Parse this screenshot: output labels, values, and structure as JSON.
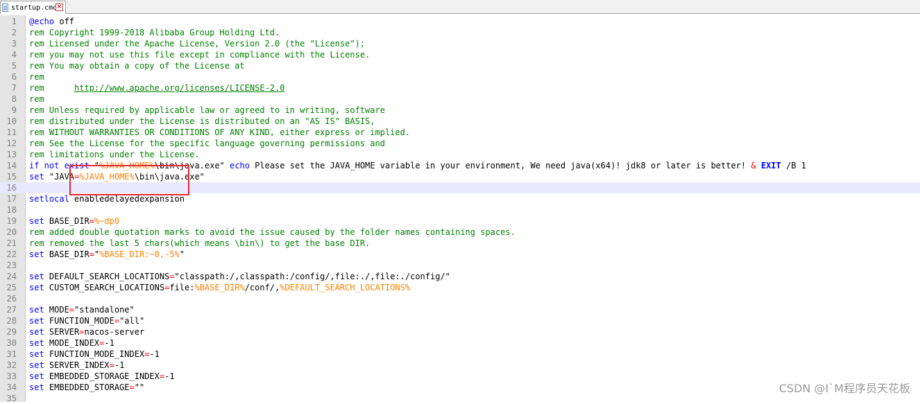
{
  "tab": {
    "title": "startup.cmd",
    "file_icon": "file-icon",
    "close_icon": "close-icon"
  },
  "colors": {
    "keyword": "#0000ff",
    "comment": "#008000",
    "variable": "#ff8000",
    "string": "#808080",
    "operator": "#ff0000",
    "current_line": "#e8e8ff",
    "highlight_box": "#e0262b"
  },
  "current_line": 16,
  "lines": [
    {
      "n": "1",
      "tokens": [
        {
          "t": "@echo",
          "c": "kw"
        },
        {
          "t": " off",
          "c": "plain"
        }
      ]
    },
    {
      "n": "2",
      "tokens": [
        {
          "t": "rem Copyright 1999-2018 Alibaba Group Holding Ltd.",
          "c": "comment"
        }
      ]
    },
    {
      "n": "3",
      "tokens": [
        {
          "t": "rem Licensed under the Apache License, Version 2.0 (the \"License\");",
          "c": "comment"
        }
      ]
    },
    {
      "n": "4",
      "tokens": [
        {
          "t": "rem you may not use this file except in compliance with the License.",
          "c": "comment"
        }
      ]
    },
    {
      "n": "5",
      "tokens": [
        {
          "t": "rem You may obtain a copy of the License at",
          "c": "comment"
        }
      ]
    },
    {
      "n": "6",
      "tokens": [
        {
          "t": "rem",
          "c": "comment"
        }
      ]
    },
    {
      "n": "7",
      "tokens": [
        {
          "t": "rem      ",
          "c": "comment"
        },
        {
          "t": "http://www.apache.org/licenses/LICENSE-2.0",
          "c": "link"
        }
      ]
    },
    {
      "n": "8",
      "tokens": [
        {
          "t": "rem",
          "c": "comment"
        }
      ]
    },
    {
      "n": "9",
      "tokens": [
        {
          "t": "rem Unless required by applicable law or agreed to in writing, software",
          "c": "comment"
        }
      ]
    },
    {
      "n": "10",
      "tokens": [
        {
          "t": "rem distributed under the License is distributed on an \"AS IS\" BASIS,",
          "c": "comment"
        }
      ]
    },
    {
      "n": "11",
      "tokens": [
        {
          "t": "rem WITHOUT WARRANTIES OR CONDITIONS OF ANY KIND, either express or implied.",
          "c": "comment"
        }
      ]
    },
    {
      "n": "12",
      "tokens": [
        {
          "t": "rem See the License for the specific language governing permissions and",
          "c": "comment"
        }
      ]
    },
    {
      "n": "13",
      "tokens": [
        {
          "t": "rem limitations under the License.",
          "c": "comment"
        }
      ]
    },
    {
      "n": "14",
      "tokens": [
        {
          "t": "if not exist",
          "c": "kw"
        },
        {
          "t": " \"",
          "c": "plain"
        },
        {
          "t": "%JAVA_HOME%",
          "c": "var"
        },
        {
          "t": "\\bin\\java.exe\" ",
          "c": "plain"
        },
        {
          "t": "echo",
          "c": "kw"
        },
        {
          "t": " Please set the JAVA_HOME variable in your environment, We need java(x64)! jdk8 or later is better! ",
          "c": "plain"
        },
        {
          "t": "&",
          "c": "op"
        },
        {
          "t": " ",
          "c": "plain"
        },
        {
          "t": "EXIT",
          "c": "kw-bold"
        },
        {
          "t": " /B 1",
          "c": "plain"
        }
      ]
    },
    {
      "n": "15",
      "tokens": [
        {
          "t": "set",
          "c": "kw"
        },
        {
          "t": " \"JAVA",
          "c": "plain"
        },
        {
          "t": "=",
          "c": "op"
        },
        {
          "t": "%JAVA_HOME%",
          "c": "var"
        },
        {
          "t": "\\bin\\java.exe\"",
          "c": "plain"
        }
      ]
    },
    {
      "n": "16",
      "tokens": []
    },
    {
      "n": "17",
      "tokens": [
        {
          "t": "setlocal",
          "c": "kw"
        },
        {
          "t": " enabledelayedexpansion",
          "c": "plain"
        }
      ]
    },
    {
      "n": "18",
      "tokens": []
    },
    {
      "n": "19",
      "tokens": [
        {
          "t": "set",
          "c": "kw"
        },
        {
          "t": " BASE_DIR",
          "c": "plain"
        },
        {
          "t": "=",
          "c": "op"
        },
        {
          "t": "%~dp0",
          "c": "var"
        }
      ]
    },
    {
      "n": "20",
      "tokens": [
        {
          "t": "rem added double quotation marks to avoid the issue caused by the folder names containing spaces.",
          "c": "comment"
        }
      ]
    },
    {
      "n": "21",
      "tokens": [
        {
          "t": "rem removed the last 5 chars(which means \\bin\\) to get the base DIR.",
          "c": "comment"
        }
      ]
    },
    {
      "n": "22",
      "tokens": [
        {
          "t": "set",
          "c": "kw"
        },
        {
          "t": " BASE_DIR",
          "c": "plain"
        },
        {
          "t": "=",
          "c": "op"
        },
        {
          "t": "\"",
          "c": "plain"
        },
        {
          "t": "%BASE_DIR:~0,-5%",
          "c": "var"
        },
        {
          "t": "\"",
          "c": "plain"
        }
      ]
    },
    {
      "n": "23",
      "tokens": []
    },
    {
      "n": "24",
      "tokens": [
        {
          "t": "set",
          "c": "kw"
        },
        {
          "t": " DEFAULT_SEARCH_LOCATIONS",
          "c": "plain"
        },
        {
          "t": "=",
          "c": "op"
        },
        {
          "t": "\"classpath:/,classpath:/config/,file:./,file:./config/\"",
          "c": "plain"
        }
      ]
    },
    {
      "n": "25",
      "tokens": [
        {
          "t": "set",
          "c": "kw"
        },
        {
          "t": " CUSTOM_SEARCH_LOCATIONS",
          "c": "plain"
        },
        {
          "t": "=",
          "c": "op"
        },
        {
          "t": "file:",
          "c": "plain"
        },
        {
          "t": "%BASE_DIR%",
          "c": "var"
        },
        {
          "t": "/conf/,",
          "c": "plain"
        },
        {
          "t": "%DEFAULT_SEARCH_LOCATIONS%",
          "c": "var"
        }
      ]
    },
    {
      "n": "26",
      "tokens": []
    },
    {
      "n": "27",
      "tokens": [
        {
          "t": "set",
          "c": "kw"
        },
        {
          "t": " MODE",
          "c": "plain"
        },
        {
          "t": "=",
          "c": "op"
        },
        {
          "t": "\"standalone\"",
          "c": "plain"
        }
      ]
    },
    {
      "n": "28",
      "tokens": [
        {
          "t": "set",
          "c": "kw"
        },
        {
          "t": " FUNCTION_MODE",
          "c": "plain"
        },
        {
          "t": "=",
          "c": "op"
        },
        {
          "t": "\"all\"",
          "c": "plain"
        }
      ]
    },
    {
      "n": "29",
      "tokens": [
        {
          "t": "set",
          "c": "kw"
        },
        {
          "t": " SERVER",
          "c": "plain"
        },
        {
          "t": "=",
          "c": "op"
        },
        {
          "t": "nacos-server",
          "c": "plain"
        }
      ]
    },
    {
      "n": "30",
      "tokens": [
        {
          "t": "set",
          "c": "kw"
        },
        {
          "t": " MODE_INDEX",
          "c": "plain"
        },
        {
          "t": "=",
          "c": "op"
        },
        {
          "t": "-1",
          "c": "plain"
        }
      ]
    },
    {
      "n": "31",
      "tokens": [
        {
          "t": "set",
          "c": "kw"
        },
        {
          "t": " FUNCTION_MODE_INDEX",
          "c": "plain"
        },
        {
          "t": "=",
          "c": "op"
        },
        {
          "t": "-1",
          "c": "plain"
        }
      ]
    },
    {
      "n": "32",
      "tokens": [
        {
          "t": "set",
          "c": "kw"
        },
        {
          "t": " SERVER_INDEX",
          "c": "plain"
        },
        {
          "t": "=",
          "c": "op"
        },
        {
          "t": "-1",
          "c": "plain"
        }
      ]
    },
    {
      "n": "33",
      "tokens": [
        {
          "t": "set",
          "c": "kw"
        },
        {
          "t": " EMBEDDED_STORAGE_INDEX",
          "c": "plain"
        },
        {
          "t": "=",
          "c": "op"
        },
        {
          "t": "-1",
          "c": "plain"
        }
      ]
    },
    {
      "n": "34",
      "tokens": [
        {
          "t": "set",
          "c": "kw"
        },
        {
          "t": " EMBEDDED_STORAGE",
          "c": "plain"
        },
        {
          "t": "=",
          "c": "op"
        },
        {
          "t": "\"\"",
          "c": "plain"
        }
      ]
    },
    {
      "n": "35",
      "tokens": []
    }
  ],
  "watermark": "CSDN @I`M程序员天花板"
}
